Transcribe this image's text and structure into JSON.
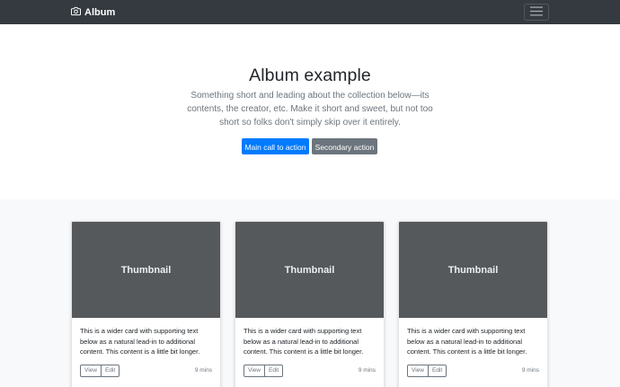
{
  "navbar": {
    "brand": "Album",
    "brand_icon": "camera-icon",
    "toggler_icon": "hamburger-menu-icon"
  },
  "jumbotron": {
    "title": "Album example",
    "lead": "Something short and leading about the collection below—its contents, the creator, etc. Make it short and sweet, but not too short so folks don't simply skip over it entirely.",
    "primary_action": "Main call to action",
    "secondary_action": "Secondary action"
  },
  "cards": [
    {
      "thumbnail": "Thumbnail",
      "text": "This is a wider card with supporting text below as a natural lead-in to additional content. This content is a little bit longer.",
      "view_label": "View",
      "edit_label": "Edit",
      "time": "9 mins"
    },
    {
      "thumbnail": "Thumbnail",
      "text": "This is a wider card with supporting text below as a natural lead-in to additional content. This content is a little bit longer.",
      "view_label": "View",
      "edit_label": "Edit",
      "time": "9 mins"
    },
    {
      "thumbnail": "Thumbnail",
      "text": "This is a wider card with supporting text below as a natural lead-in to additional content. This content is a little bit longer.",
      "view_label": "View",
      "edit_label": "Edit",
      "time": "9 mins"
    }
  ],
  "colors": {
    "navbar_bg": "#343a40",
    "primary": "#007bff",
    "secondary": "#6c757d",
    "thumbnail_bg": "#55595c",
    "album_bg": "#f8f9fa"
  }
}
